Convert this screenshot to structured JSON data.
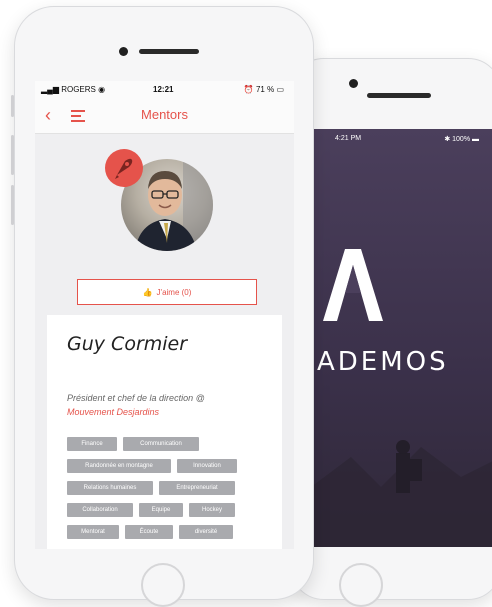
{
  "front_phone": {
    "status": {
      "carrier": "ROGERS",
      "time": "12:21",
      "battery": "71 %"
    },
    "nav": {
      "title": "Mentors"
    },
    "like_button": {
      "label": "J'aime (0)"
    },
    "profile": {
      "name": "Guy Cormier",
      "role": "Président et chef de la direction @",
      "organization": "Mouvement Desjardins",
      "tags": [
        "Finance",
        "Communication",
        "Randonnée en montagne",
        "Innovation",
        "Relations humaines",
        "Entrepreneuriat",
        "Collaboration",
        "Equipe",
        "Hockey",
        "Mentorat",
        "Écoute",
        "diversité"
      ]
    }
  },
  "back_phone": {
    "status": {
      "time": "4:21 PM",
      "battery": "100%"
    },
    "brand": "ADEMOS"
  },
  "colors": {
    "accent": "#e5534b",
    "tag_bg": "#a9aaae",
    "splash_bg": "#4b3f5c"
  }
}
